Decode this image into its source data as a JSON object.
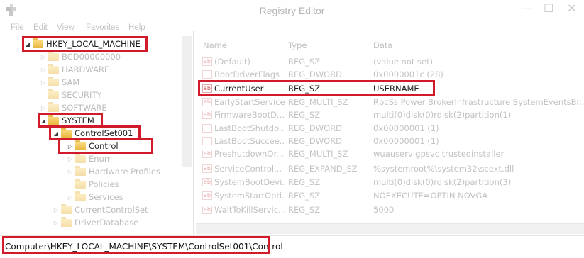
{
  "window": {
    "title": "Registry Editor",
    "minimize": "—",
    "maximize": "☐",
    "close": "✕"
  },
  "menu": [
    "File",
    "Edit",
    "View",
    "Favorites",
    "Help"
  ],
  "tree": [
    {
      "label": "HKEY_LOCAL_MACHINE",
      "expander": "◢",
      "highlighted": true
    },
    {
      "label": "BCD00000000",
      "expander": "▷"
    },
    {
      "label": "HARDWARE",
      "expander": "▷"
    },
    {
      "label": "SAM",
      "expander": "▷"
    },
    {
      "label": "SECURITY",
      "expander": ""
    },
    {
      "label": "SOFTWARE",
      "expander": "▷"
    },
    {
      "label": "SYSTEM",
      "expander": "◢",
      "highlighted": true
    },
    {
      "label": "ControlSet001",
      "expander": "◢",
      "highlighted": true
    },
    {
      "label": "Control",
      "expander": "▷",
      "highlighted": true
    },
    {
      "label": "Enum",
      "expander": "▷"
    },
    {
      "label": "Hardware Profiles",
      "expander": "▷"
    },
    {
      "label": "Policies",
      "expander": ""
    },
    {
      "label": "Services",
      "expander": "▷"
    },
    {
      "label": "CurrentControlSet",
      "expander": "▷"
    },
    {
      "label": "DriverDatabase",
      "expander": "▷"
    }
  ],
  "list": {
    "columns": [
      "Name",
      "Type",
      "Data"
    ],
    "value_icon": "ab",
    "rows": [
      {
        "name": "(Default)",
        "type": "REG_SZ",
        "data": "(value not set)"
      },
      {
        "name": "BootDriverFlags",
        "type": "REG_DWORD",
        "data": "0x0000001c (28)"
      },
      {
        "name": "CurrentUser",
        "type": "REG_SZ",
        "data": "USERNAME",
        "highlighted": true
      },
      {
        "name": "EarlyStartServices",
        "type": "REG_MULTI_SZ",
        "data": "RpcSs Power BrokerInfrastructure SystemEventsBr..."
      },
      {
        "name": "FirmwareBootD...",
        "type": "REG_SZ",
        "data": "multi(0)disk(0)rdisk(2)partition(1)"
      },
      {
        "name": "LastBootShutdo...",
        "type": "REG_DWORD",
        "data": "0x00000001 (1)"
      },
      {
        "name": "LastBootSuccee...",
        "type": "REG_DWORD",
        "data": "0x00000001 (1)"
      },
      {
        "name": "PreshutdownOr...",
        "type": "REG_MULTI_SZ",
        "data": "wuauserv gpsvc trustedinstaller"
      },
      {
        "name": "ServiceControl...",
        "type": "REG_EXPAND_SZ",
        "data": "%systemroot%\\system32\\scext.dll"
      },
      {
        "name": "SystemBootDevi...",
        "type": "REG_SZ",
        "data": "multi(0)disk(0)rdisk(2)partition(3)"
      },
      {
        "name": "SystemStartOpti...",
        "type": "REG_SZ",
        "data": " NOEXECUTE=OPTIN  NOVGA"
      },
      {
        "name": "WaitToKillServic...",
        "type": "REG_SZ",
        "data": "5000"
      }
    ]
  },
  "status": {
    "path": "Computer\\HKEY_LOCAL_MACHINE\\SYSTEM\\ControlSet001\\Control"
  },
  "colors": {
    "highlight_border": "#d11a2a",
    "faded_text": "#bcbcbc"
  }
}
